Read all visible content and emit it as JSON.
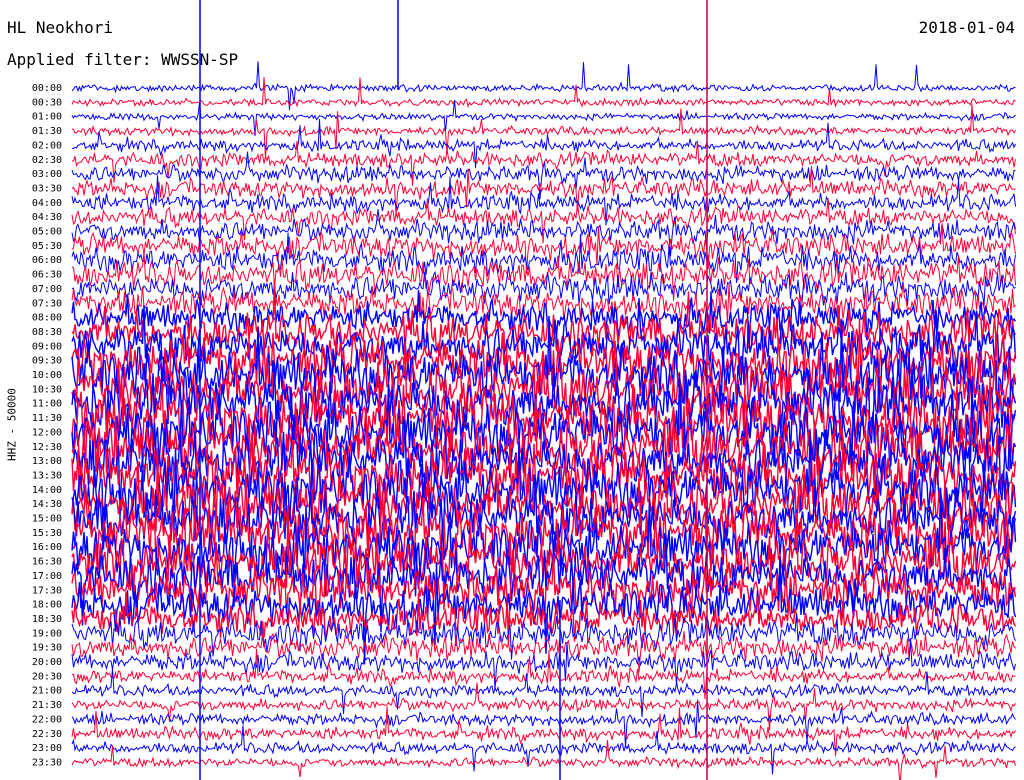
{
  "header": {
    "station": "HL Neokhori",
    "filter": "Applied filter: WWSSN-SP",
    "date": "2018-01-04"
  },
  "chart_data": {
    "type": "line",
    "title": "HL Neokhori",
    "subtitle": "Applied filter: WWSSN-SP",
    "date": "2018-01-04",
    "ylabel": "HHZ - 50000",
    "xlabel": "",
    "row_labels": [
      "00:00",
      "00:30",
      "01:00",
      "01:30",
      "02:00",
      "02:30",
      "03:00",
      "03:30",
      "04:00",
      "04:30",
      "05:00",
      "05:30",
      "06:00",
      "06:30",
      "07:00",
      "07:30",
      "08:00",
      "08:30",
      "09:00",
      "09:30",
      "10:00",
      "10:30",
      "11:00",
      "11:30",
      "12:00",
      "12:30",
      "13:00",
      "13:30",
      "14:00",
      "14:30",
      "15:00",
      "15:30",
      "16:00",
      "16:30",
      "17:00",
      "17:30",
      "18:00",
      "18:30",
      "19:00",
      "19:30",
      "20:00",
      "20:30",
      "21:00",
      "21:30",
      "22:00",
      "22:30",
      "23:00",
      "23:30"
    ],
    "series_colors": [
      "#0000ff",
      "#ff0033"
    ],
    "row_activity": [
      0.08,
      0.08,
      0.08,
      0.15,
      0.3,
      0.45,
      0.5,
      0.55,
      0.55,
      0.6,
      0.7,
      0.8,
      0.9,
      1.0,
      1.0,
      1.0,
      1.1,
      1.4,
      1.6,
      1.8,
      2.0,
      2.1,
      2.2,
      2.2,
      2.2,
      2.2,
      2.1,
      2.1,
      2.1,
      2.0,
      2.0,
      2.0,
      1.9,
      1.9,
      1.8,
      1.6,
      1.4,
      1.2,
      1.0,
      0.8,
      0.6,
      0.4,
      0.3,
      0.3,
      0.3,
      0.35,
      0.3,
      0.2
    ]
  }
}
